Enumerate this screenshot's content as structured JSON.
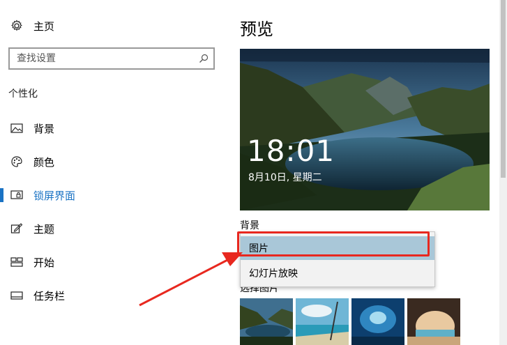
{
  "sidebar": {
    "home_label": "主页",
    "search_placeholder": "查找设置",
    "section_title": "个性化",
    "items": [
      {
        "label": "背景",
        "icon": "picture-icon"
      },
      {
        "label": "颜色",
        "icon": "palette-icon"
      },
      {
        "label": "锁屏界面",
        "icon": "lock-screen-icon",
        "active": true
      },
      {
        "label": "主题",
        "icon": "theme-icon"
      },
      {
        "label": "开始",
        "icon": "start-icon"
      },
      {
        "label": "任务栏",
        "icon": "taskbar-icon"
      }
    ]
  },
  "main": {
    "title": "预览",
    "preview": {
      "time": "18:01",
      "date": "8月10日, 星期二"
    },
    "background_label": "背景",
    "dropdown": {
      "options": [
        "图片",
        "幻灯片放映"
      ],
      "selected": "图片"
    },
    "choose_label": "选择图片"
  },
  "colors": {
    "accent": "#1b73c4",
    "highlight_red": "#e8281f",
    "dropdown_selected": "#a9c7d8"
  }
}
